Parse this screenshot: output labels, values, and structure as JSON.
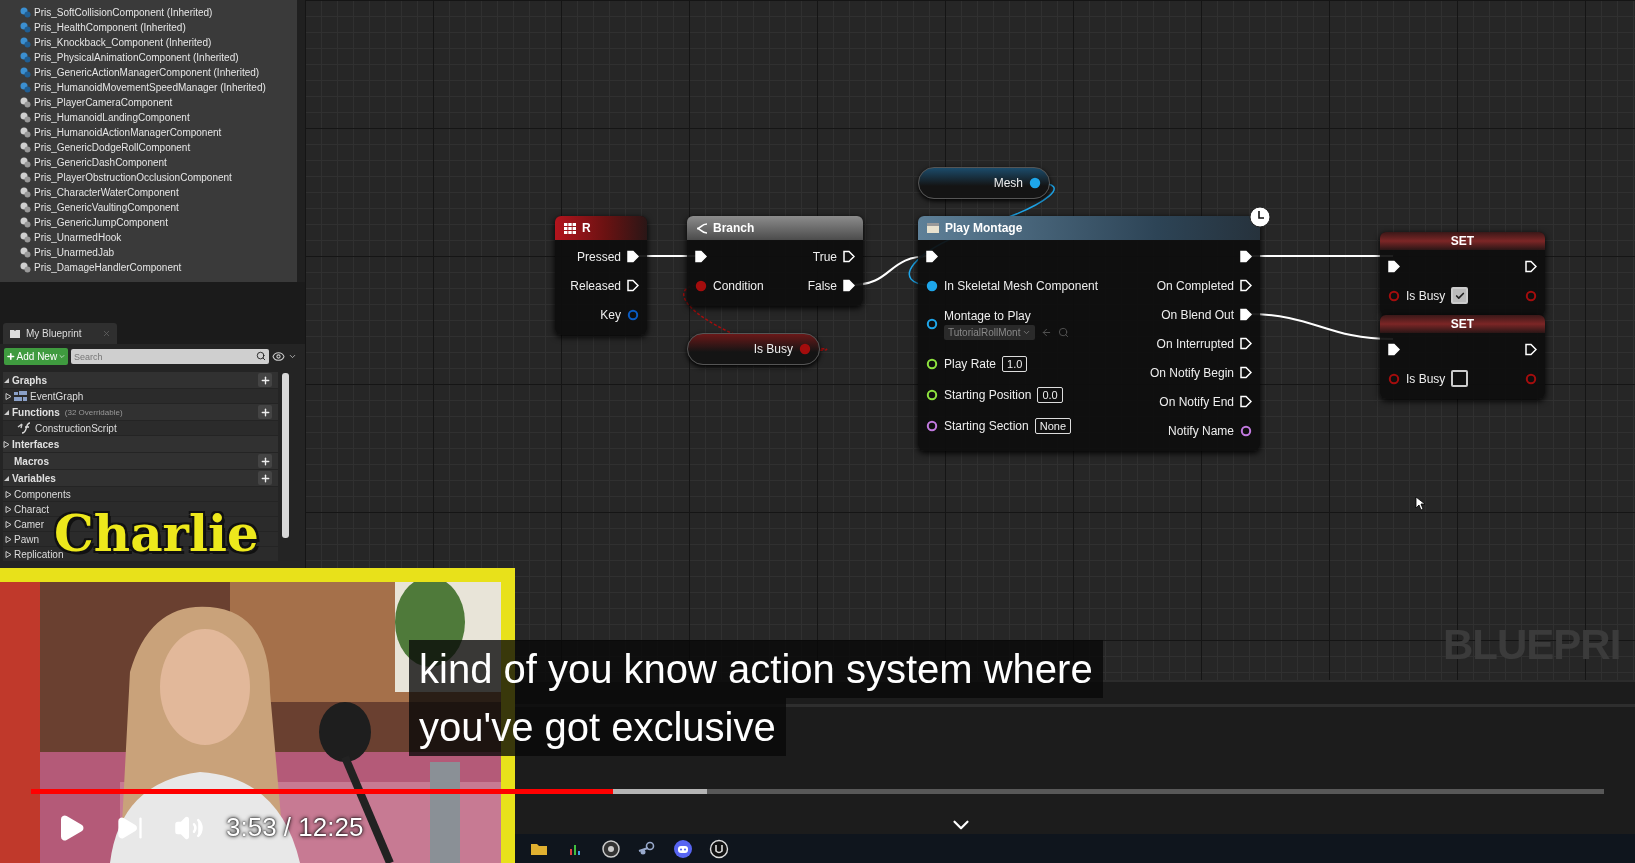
{
  "components": [
    {
      "label": "Pris_SoftCollisionComponent (Inherited)",
      "inherited": true
    },
    {
      "label": "Pris_HealthComponent (Inherited)",
      "inherited": true
    },
    {
      "label": "Pris_Knockback_Component (Inherited)",
      "inherited": true
    },
    {
      "label": "Pris_PhysicalAnimationComponent (Inherited)",
      "inherited": true
    },
    {
      "label": "Pris_GenericActionManagerComponent (Inherited)",
      "inherited": true
    },
    {
      "label": "Pris_HumanoidMovementSpeedManager (Inherited)",
      "inherited": true
    },
    {
      "label": "Pris_PlayerCameraComponent",
      "inherited": false
    },
    {
      "label": "Pris_HumanoidLandingComponent",
      "inherited": false
    },
    {
      "label": "Pris_HumanoidActionManagerComponent",
      "inherited": false
    },
    {
      "label": "Pris_GenericDodgeRollComponent",
      "inherited": false
    },
    {
      "label": "Pris_GenericDashComponent",
      "inherited": false
    },
    {
      "label": "Pris_PlayerObstructionOcclusionComponent",
      "inherited": false
    },
    {
      "label": "Pris_CharacterWaterComponent",
      "inherited": false
    },
    {
      "label": "Pris_GenericVaultingComponent",
      "inherited": false
    },
    {
      "label": "Pris_GenericJumpComponent",
      "inherited": false
    },
    {
      "label": "Pris_UnarmedHook",
      "inherited": false
    },
    {
      "label": "Pris_UnarmedJab",
      "inherited": false
    },
    {
      "label": "Pris_DamageHandlerComponent",
      "inherited": false
    }
  ],
  "my_blueprint": {
    "tab": "My Blueprint",
    "add_button": "Add New",
    "search": {
      "placeholder": "Search"
    },
    "sections": [
      {
        "label": "Graphs",
        "expanded": true,
        "addable": true,
        "children": [
          {
            "label": "EventGraph",
            "kind": "graph",
            "expanded": false
          }
        ]
      },
      {
        "label": "Functions",
        "note": "(32 Overridable)",
        "expanded": true,
        "addable": true,
        "children": [
          {
            "label": "ConstructionScript",
            "kind": "function"
          }
        ]
      },
      {
        "label": "Interfaces",
        "expanded": false,
        "addable": false
      },
      {
        "label": "Macros",
        "addable": true
      },
      {
        "label": "Variables",
        "expanded": true,
        "addable": true,
        "children": [
          {
            "label": "Components",
            "kind": "category",
            "expanded": false
          },
          {
            "label": "Charact",
            "kind": "category",
            "expanded": false
          },
          {
            "label": "Camer",
            "kind": "category",
            "expanded": false
          },
          {
            "label": "Pawn",
            "kind": "category",
            "expanded": false
          },
          {
            "label": "Replication",
            "kind": "category",
            "expanded": false
          }
        ]
      }
    ]
  },
  "graph": {
    "watermark": "BLUEPRI",
    "nodes": [
      {
        "kind": "event",
        "title": "R",
        "outputs": [
          {
            "label": "Pressed",
            "kind": "exec",
            "connected": true
          },
          {
            "label": "Released",
            "kind": "exec",
            "connected": false
          },
          {
            "label": "Key",
            "kind": "struct",
            "connected": false
          }
        ]
      },
      {
        "kind": "flow",
        "title": "Branch",
        "inputs": [
          {
            "kind": "exec",
            "connected": true
          },
          {
            "label": "Condition",
            "kind": "bool",
            "connected": true
          }
        ],
        "outputs": [
          {
            "label": "True",
            "kind": "exec",
            "connected": false
          },
          {
            "label": "False",
            "kind": "exec",
            "connected": true
          }
        ]
      },
      {
        "kind": "getter",
        "outputs": [
          {
            "label": "Is Busy",
            "kind": "bool",
            "connected": true
          }
        ]
      },
      {
        "kind": "getter",
        "outputs": [
          {
            "label": "Mesh",
            "kind": "object",
            "connected": true
          }
        ]
      },
      {
        "kind": "function",
        "title": "Play Montage",
        "latent": true,
        "inputs": [
          {
            "kind": "exec",
            "connected": true
          },
          {
            "label": "In Skeletal Mesh Component",
            "kind": "object",
            "connected": true
          },
          {
            "label": "Montage to Play",
            "kind": "object",
            "connected": false,
            "value": "TutorialRollMont"
          },
          {
            "label": "Play Rate",
            "kind": "float",
            "connected": false,
            "value": "1.0"
          },
          {
            "label": "Starting Position",
            "kind": "float",
            "connected": false,
            "value": "0.0"
          },
          {
            "label": "Starting Section",
            "kind": "name",
            "connected": false,
            "value": "None"
          }
        ],
        "outputs": [
          {
            "kind": "exec",
            "connected": true
          },
          {
            "label": "On Completed",
            "kind": "exec",
            "connected": false
          },
          {
            "label": "On Blend Out",
            "kind": "exec",
            "connected": true
          },
          {
            "label": "On Interrupted",
            "kind": "exec",
            "connected": false
          },
          {
            "label": "On Notify Begin",
            "kind": "exec",
            "connected": false
          },
          {
            "label": "On Notify End",
            "kind": "exec",
            "connected": false
          },
          {
            "label": "Notify Name",
            "kind": "name",
            "connected": false
          }
        ]
      },
      {
        "kind": "setter",
        "title": "SET",
        "inputs": [
          {
            "kind": "exec",
            "connected": true
          },
          {
            "label": "Is Busy",
            "kind": "bool",
            "connected": false,
            "checked": true
          }
        ],
        "outputs": [
          {
            "kind": "exec",
            "connected": false
          },
          {
            "kind": "bool",
            "connected": false
          }
        ]
      },
      {
        "kind": "setter",
        "title": "SET",
        "inputs": [
          {
            "kind": "exec",
            "connected": true
          },
          {
            "label": "Is Busy",
            "kind": "bool",
            "connected": false,
            "checked": false
          }
        ],
        "outputs": [
          {
            "kind": "exec",
            "connected": false
          },
          {
            "kind": "bool",
            "connected": false
          }
        ]
      }
    ]
  },
  "video": {
    "name_tag": "Charlie",
    "captions": [
      "kind of you know action system where",
      "you've got exclusive"
    ],
    "progress": {
      "level": 0.37
    },
    "buffer": {
      "level": 0.43
    },
    "time": "3:53 / 12:25"
  }
}
